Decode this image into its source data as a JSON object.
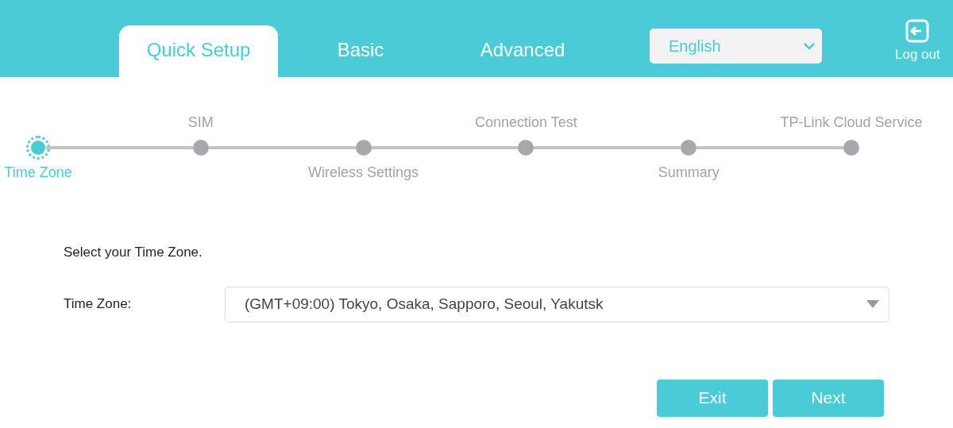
{
  "tabs": [
    {
      "label": "Quick Setup",
      "selected": true
    },
    {
      "label": "Basic",
      "selected": false
    },
    {
      "label": "Advanced",
      "selected": false
    }
  ],
  "language": {
    "value": "English"
  },
  "logout": {
    "label": "Log out"
  },
  "steps": [
    {
      "label": "Time Zone",
      "selected": true
    },
    {
      "label": "SIM",
      "selected": false
    },
    {
      "label": "Wireless Settings",
      "selected": false
    },
    {
      "label": "Connection Test",
      "selected": false
    },
    {
      "label": "Summary",
      "selected": false
    },
    {
      "label": "TP-Link Cloud Service",
      "selected": false
    }
  ],
  "intro": "Select your Time Zone.",
  "time_zone": {
    "label": "Time Zone:",
    "value": "(GMT+09:00) Tokyo, Osaka, Sapporo, Seoul, Yakutsk"
  },
  "buttons": [
    "Exit",
    "Next"
  ]
}
